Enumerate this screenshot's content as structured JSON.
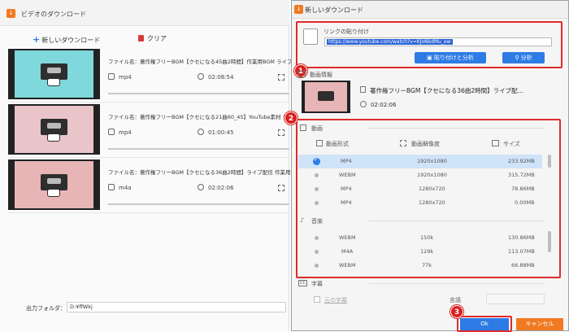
{
  "main": {
    "title": "ビデオのダウンロード",
    "app_icon": "down-arrow-icon",
    "toolbar": {
      "new_download": "新しいダウンロード",
      "clear": "クリア"
    },
    "items": [
      {
        "filename": "ファイル名：著作権フリーBGM【クセになる45曲2時間】作業用BGM ライブ配信",
        "format": "mp4",
        "duration": "02:08:54",
        "thumb_color": "#7fd9dc"
      },
      {
        "filename": "ファイル名：著作権フリーBGM【クセになる21曲60_45】YouTube素材 ライ",
        "format": "mp4",
        "duration": "01:00:45",
        "thumb_color": "#e9c4c8"
      },
      {
        "filename": "ファイル名：著作権フリーBGM【クセになる36曲2時間】ライブ配信 作業用 勉強",
        "format": "m4a",
        "duration": "02:02:06",
        "thumb_color": "#e7b5b5"
      }
    ],
    "output_label": "出力フォルダ：",
    "output_path": "D:¥ffWkj"
  },
  "dialog": {
    "title": "新しいダウンロード",
    "paste_label": "リンクの貼り付け",
    "url": "https://www.youtube.com/watch?v=KJoNkdMu_ew",
    "paste_analyze": "貼り付けと分析",
    "analyze": "分析",
    "video_info_label": "動画情報",
    "video_title": "著作権フリーBGM【クセになる36曲2時間】ライブ配...",
    "video_duration": "02:02:06",
    "video_section": "動画",
    "headers": {
      "format": "動画形式",
      "resolution": "動画解像度",
      "size": "サイズ"
    },
    "video_rows": [
      {
        "format": "MP4",
        "res": "1920x1080",
        "size": "233.92MB",
        "selected": true
      },
      {
        "format": "WEBM",
        "res": "1920x1080",
        "size": "315.72MB",
        "selected": false
      },
      {
        "format": "MP4",
        "res": "1280x720",
        "size": "78.86MB",
        "selected": false
      },
      {
        "format": "MP4",
        "res": "1280x720",
        "size": "0.00MB",
        "selected": false
      }
    ],
    "audio_section": "音楽",
    "audio_rows": [
      {
        "format": "WEBM",
        "res": "150k",
        "size": "130.86MB"
      },
      {
        "format": "M4A",
        "res": "129k",
        "size": "113.07MB"
      },
      {
        "format": "WEBM",
        "res": "77k",
        "size": "66.88MB"
      }
    ],
    "subtitle_section": "字幕",
    "original_sub": "元の字幕",
    "language_label": "言語",
    "ok": "Ok",
    "cancel": "キャンセル",
    "badges": [
      "1",
      "2",
      "3"
    ],
    "colors": {
      "accent": "#2d7be5",
      "highlight": "#e02a2a",
      "cancel": "#f07a22"
    }
  }
}
